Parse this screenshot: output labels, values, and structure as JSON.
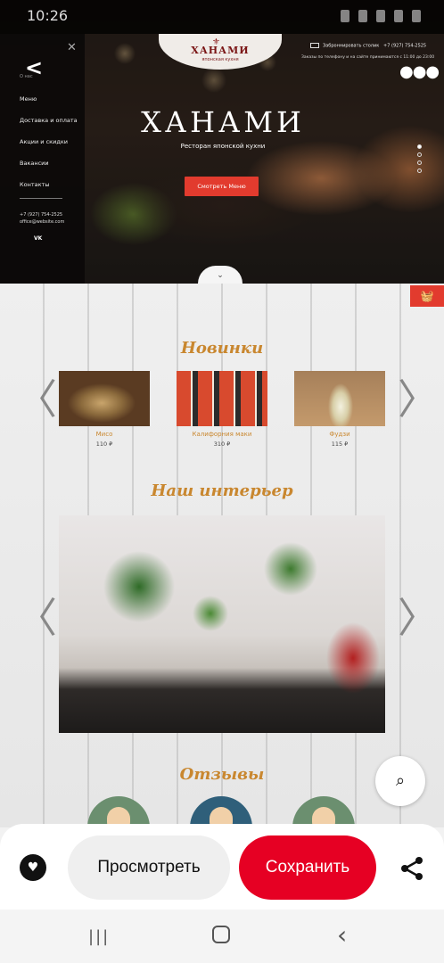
{
  "status_bar": {
    "time": "10:26"
  },
  "hero": {
    "logo": {
      "mark": "⚜",
      "name": "ХАНАМИ",
      "subtitle": "японская кухня"
    },
    "contact": {
      "callback": "Заброннировать столик",
      "phone": "+7 (927) 754-2525"
    },
    "hours": "Заказы по телефону и на сайте принимаются с 11:00 до 23:00",
    "title": "ХАНАМИ",
    "subtitle": "Ресторан японской кухни",
    "cta_label": "Смотреть Меню",
    "scroll_icon": "⌄"
  },
  "side_menu": {
    "about": "О нас",
    "items": [
      {
        "label": "Меню"
      },
      {
        "label": "Доставка и оплата"
      },
      {
        "label": "Акции и скидки"
      },
      {
        "label": "Вакансии"
      },
      {
        "label": "Контакты"
      }
    ],
    "phone": "+7 (927) 754-2525",
    "email": "office@website.com",
    "social": "VK"
  },
  "sections": {
    "new": {
      "title": "Новинки",
      "products": [
        {
          "name": "Мисо",
          "price": "110 ₽"
        },
        {
          "name": "Калифорния маки",
          "price": "310 ₽"
        },
        {
          "name": "Фудзи",
          "price": "115 ₽"
        }
      ]
    },
    "interior": {
      "title": "Наш интерьер"
    },
    "reviews": {
      "title": "Отзывы"
    }
  },
  "arrows": {
    "left": "〈",
    "right": "〉"
  },
  "action_bar": {
    "view_label": "Просмотреть",
    "save_label": "Сохранить"
  },
  "colors": {
    "accent_red": "#e60023",
    "site_red": "#e23b2e",
    "heading_gold": "#c9872f"
  }
}
